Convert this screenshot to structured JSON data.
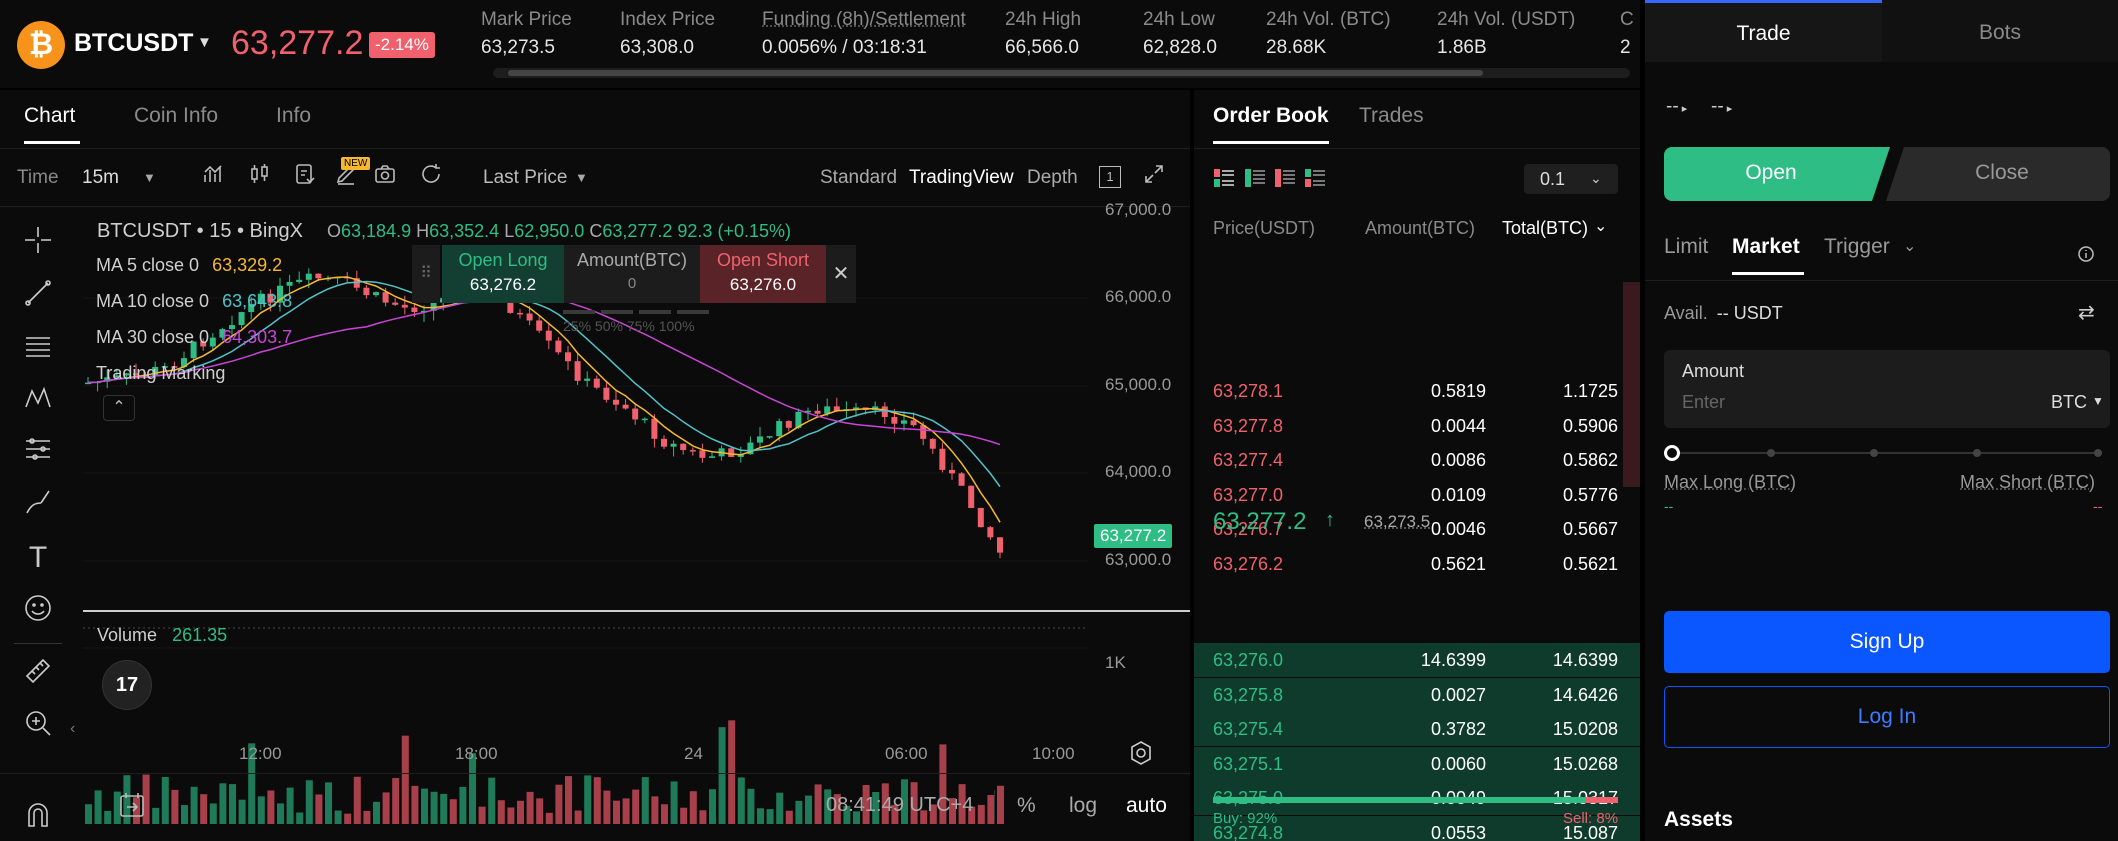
{
  "header": {
    "symbol": "BTCUSDT",
    "coin_glyph": "₿",
    "last_price": "63,277.2",
    "change": "-2.14%",
    "stats": [
      {
        "label": "Mark Price",
        "value": "63,273.5"
      },
      {
        "label": "Index Price",
        "value": "63,308.0"
      },
      {
        "label": "Funding (8h)/Settlement",
        "value": "0.0056% / 03:18:31"
      },
      {
        "label": "24h High",
        "value": "66,566.0"
      },
      {
        "label": "24h Low",
        "value": "62,828.0"
      },
      {
        "label": "24h Vol. (BTC)",
        "value": "28.68K"
      },
      {
        "label": "24h Vol. (USDT)",
        "value": "1.86B"
      },
      {
        "label": "C",
        "value": "2"
      }
    ]
  },
  "chart_panel": {
    "tabs": [
      "Chart",
      "Coin Info",
      "Info"
    ],
    "time_label": "Time",
    "interval": "15m",
    "price_source": "Last Price",
    "new_badge": "NEW",
    "views": [
      "Standard",
      "TradingView",
      "Depth"
    ],
    "legend": {
      "title": "BTCUSDT • 15 • BingX",
      "o_label": "O",
      "o": "63,184.9",
      "h_label": "H",
      "h": "63,352.4",
      "l_label": "L",
      "l": "62,950.0",
      "c_label": "C",
      "c": "63,277.2",
      "chg": "92.3 (+0.15%)",
      "ma5_label": "MA 5 close 0",
      "ma5": "63,329.2",
      "ma10_label": "MA 10 close 0",
      "ma10": "63,643.8",
      "ma30_label": "MA 30 close 0",
      "ma30": "64,303.7",
      "trading_marking": "Trading Marking"
    },
    "trade_widget": {
      "open_long": "Open Long",
      "long_price": "63,276.2",
      "amount": "Amount(BTC)",
      "amount_value": "0",
      "open_short": "Open Short",
      "short_price": "63,276.0",
      "pcts": "25%  50%  75%  100%"
    },
    "volume_label": "Volume",
    "volume_value": "261.35",
    "price_axis": [
      "67,000.0",
      "66,000.0",
      "65,000.0",
      "64,000.0",
      "63,000.0"
    ],
    "price_tag": "63,277.2",
    "volume_axis": "1K",
    "time_axis": [
      "12:00",
      "18:00",
      "24",
      "06:00",
      "10:00"
    ],
    "clock": "08:41:49 UTC+4",
    "bottom_opts": [
      "%",
      "log",
      "auto"
    ],
    "colors": {
      "up": "#2ebd85",
      "down": "#f0616d",
      "ma5": "#f5b82e",
      "ma10": "#4fc3c9",
      "ma30": "#c845d6"
    }
  },
  "order_book": {
    "tabs": [
      "Order Book",
      "Trades"
    ],
    "precision": "0.1",
    "columns": [
      "Price(USDT)",
      "Amount(BTC)",
      "Total(BTC)"
    ],
    "asks": [
      {
        "price": "63,278.1",
        "amount": "0.5819",
        "total": "1.1725"
      },
      {
        "price": "63,277.8",
        "amount": "0.0044",
        "total": "0.5906"
      },
      {
        "price": "63,277.4",
        "amount": "0.0086",
        "total": "0.5862"
      },
      {
        "price": "63,277.0",
        "amount": "0.0109",
        "total": "0.5776"
      },
      {
        "price": "63,276.7",
        "amount": "0.0046",
        "total": "0.5667"
      },
      {
        "price": "63,276.2",
        "amount": "0.5621",
        "total": "0.5621"
      }
    ],
    "mid_price": "63,277.2",
    "mid_mark": "63,273.5",
    "bids": [
      {
        "price": "63,276.0",
        "amount": "14.6399",
        "total": "14.6399"
      },
      {
        "price": "63,275.8",
        "amount": "0.0027",
        "total": "14.6426"
      },
      {
        "price": "63,275.4",
        "amount": "0.3782",
        "total": "15.0208"
      },
      {
        "price": "63,275.1",
        "amount": "0.0060",
        "total": "15.0268"
      },
      {
        "price": "63,275.0",
        "amount": "0.0049",
        "total": "15.0317"
      },
      {
        "price": "63,274.8",
        "amount": "0.0553",
        "total": "15.087"
      }
    ],
    "buy_ratio": "Buy: 92%",
    "sell_ratio": "Sell: 8%",
    "buy_fraction": 0.92
  },
  "trade_panel": {
    "tabs": [
      "Trade",
      "Bots"
    ],
    "leverage_placeholder": [
      "--",
      "--"
    ],
    "open": "Open",
    "close": "Close",
    "order_types": [
      "Limit",
      "Market",
      "Trigger"
    ],
    "avail_label": "Avail.",
    "avail_value": "-- USDT",
    "amount_label": "Amount",
    "amount_placeholder": "Enter",
    "amount_unit": "BTC",
    "max_long": "Max Long (BTC)",
    "max_short": "Max Short (BTC)",
    "max_long_value": "--",
    "max_short_value": "--",
    "sign_up": "Sign Up",
    "log_in": "Log In",
    "assets": "Assets"
  }
}
